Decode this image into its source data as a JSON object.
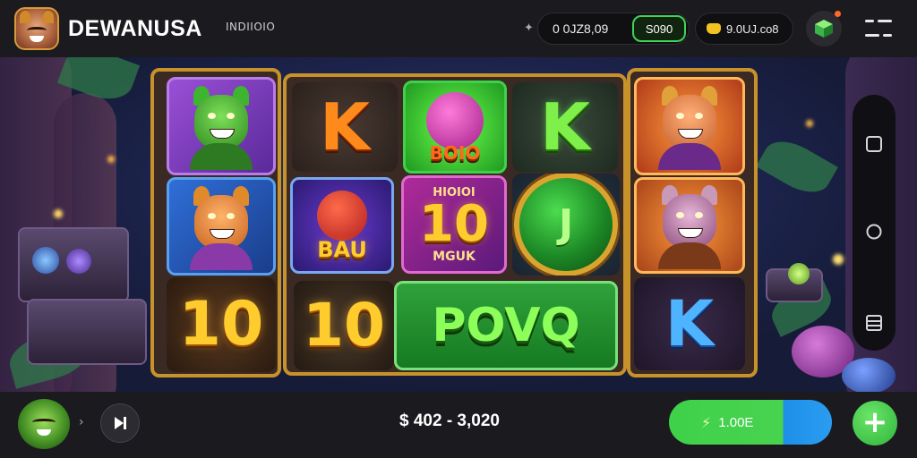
{
  "header": {
    "brand": "DEWANUSA",
    "brand_sub": "INDIIOIO",
    "balance": "0 0JZ8,09",
    "balance_chip": "S090",
    "coins": "9.0UJ.co8"
  },
  "reels": {
    "mid_row1": {
      "left": "K",
      "orb_label": "BOIO",
      "right": "K"
    },
    "mid_row2": {
      "orb_label": "BAU",
      "tile_top": "HIOIOI",
      "tile_num": "10",
      "tile_bottom": "MGUK",
      "coin_glyph": "J"
    },
    "left_bottom": "10",
    "mid_bottom_num": "10",
    "mid_bottom_word": "POVQ",
    "right_bottom": "K"
  },
  "footer": {
    "bet_range": "$ 402 - 3,020",
    "spin_label": "1.00E"
  },
  "colors": {
    "accent_green": "#3fd14a",
    "accent_blue": "#2a9df2",
    "frame_gold": "#c8922b"
  },
  "icons": [
    "brand-avatar-icon",
    "cube-icon",
    "menu-icon",
    "square-icon",
    "circle-icon",
    "list-icon",
    "skip-icon",
    "bolt-icon",
    "plus-icon"
  ]
}
